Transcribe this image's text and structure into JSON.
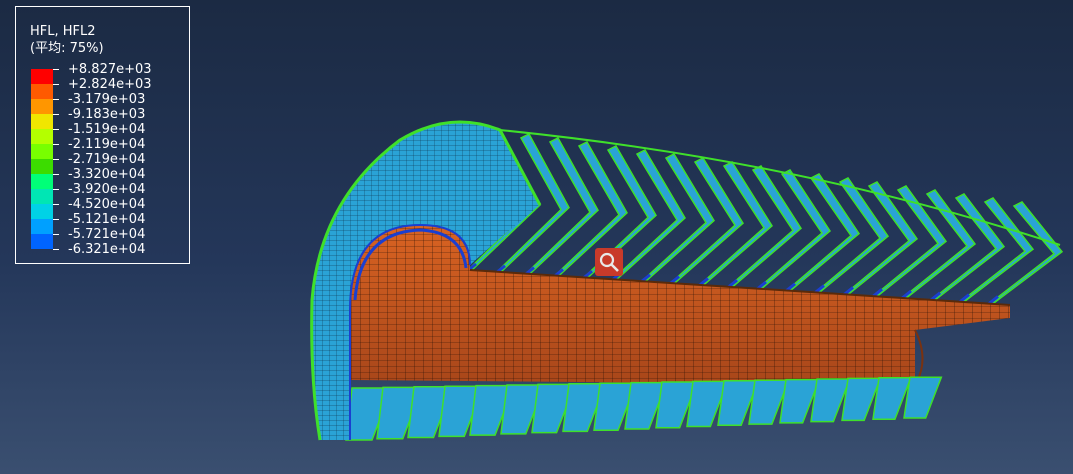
{
  "legend": {
    "title": "HFL, HFL2",
    "subtitle": "(平均: 75%)",
    "entries": [
      {
        "value": "+8.827e+03",
        "color": "#ff0000"
      },
      {
        "value": "+2.824e+03",
        "color": "#ff5a00"
      },
      {
        "value": "-3.179e+03",
        "color": "#ff9600"
      },
      {
        "value": "-9.183e+03",
        "color": "#f0e600"
      },
      {
        "value": "-1.519e+04",
        "color": "#b4ff00"
      },
      {
        "value": "-2.119e+04",
        "color": "#78ff00"
      },
      {
        "value": "-2.719e+04",
        "color": "#3cdc00"
      },
      {
        "value": "-3.320e+04",
        "color": "#00ff78"
      },
      {
        "value": "-3.920e+04",
        "color": "#00e6b4"
      },
      {
        "value": "-4.520e+04",
        "color": "#00d2e6"
      },
      {
        "value": "-5.121e+04",
        "color": "#00a0ff"
      },
      {
        "value": "-5.721e+04",
        "color": "#0064ff"
      },
      {
        "value": "-6.321e+04",
        "color": "#0000ff"
      }
    ]
  },
  "viewport": {
    "fin_count": 19,
    "colors": {
      "fin_face": "#2aa3d6",
      "fin_edge": "#3fe02a",
      "fin_tip": "#1a3fd0",
      "tube": "#c8541c",
      "tube_dark": "#9a3e12",
      "mesh_line": "#101010",
      "query_icon": "#c83a2a"
    }
  }
}
